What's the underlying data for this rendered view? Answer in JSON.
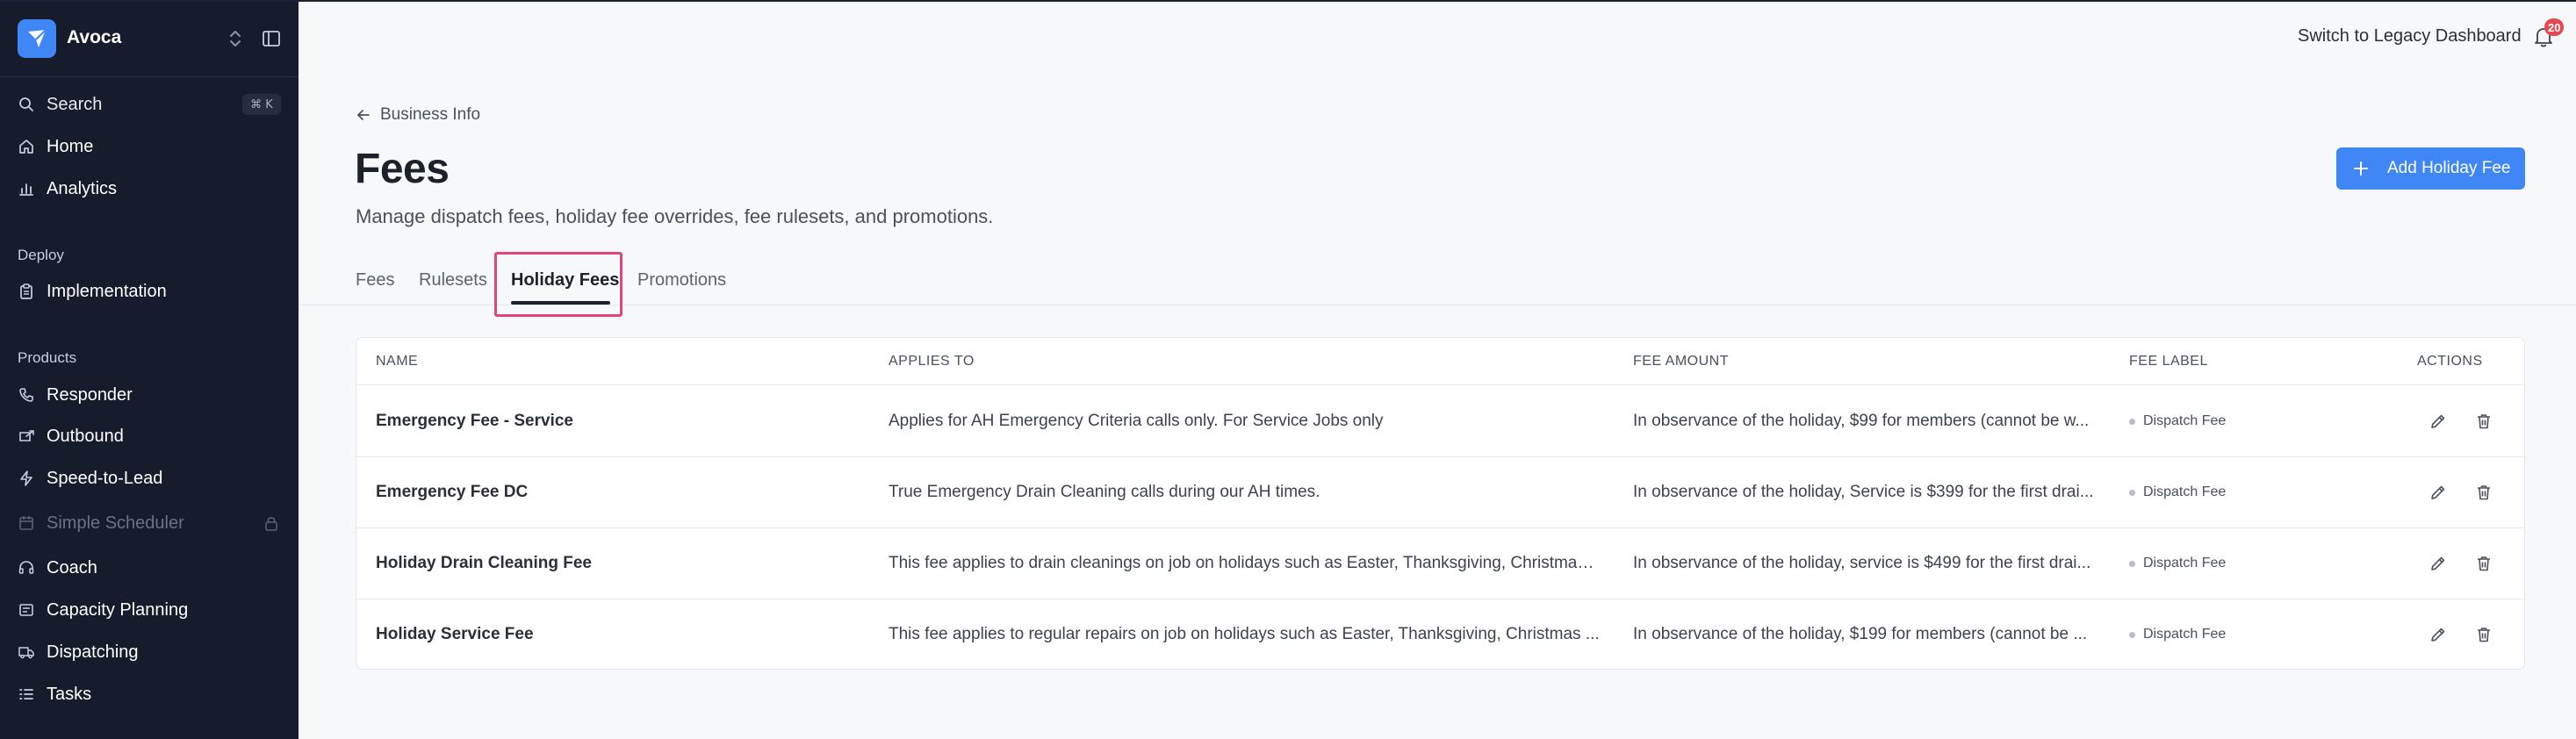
{
  "app": {
    "name": "Avoca"
  },
  "sidebar": {
    "search": {
      "label": "Search",
      "shortcut": "⌘ K"
    },
    "top_items": [
      {
        "label": "Home",
        "icon": "home-icon"
      },
      {
        "label": "Analytics",
        "icon": "bar-chart-icon"
      }
    ],
    "deploy_heading": "Deploy",
    "deploy_items": [
      {
        "label": "Implementation",
        "icon": "clipboard-icon"
      }
    ],
    "products_heading": "Products",
    "product_items": [
      {
        "label": "Responder",
        "icon": "phone-icon"
      },
      {
        "label": "Outbound",
        "icon": "outbound-icon"
      },
      {
        "label": "Speed-to-Lead",
        "icon": "bolt-icon"
      },
      {
        "label": "Simple Scheduler",
        "icon": "calendar-icon",
        "disabled": true
      },
      {
        "label": "Coach",
        "icon": "headset-icon"
      },
      {
        "label": "Capacity Planning",
        "icon": "sliders-icon"
      },
      {
        "label": "Dispatching",
        "icon": "truck-icon"
      },
      {
        "label": "Tasks",
        "icon": "list-icon"
      }
    ]
  },
  "header": {
    "legacy_link": "Switch to Legacy Dashboard",
    "notification_count": "20"
  },
  "page": {
    "back_label": "Business Info",
    "title": "Fees",
    "subtitle": "Manage dispatch fees, holiday fee overrides, fee rulesets, and promotions.",
    "add_button": "Add Holiday Fee",
    "tabs": [
      {
        "label": "Fees",
        "active": false
      },
      {
        "label": "Rulesets",
        "active": false
      },
      {
        "label": "Holiday Fees",
        "active": true
      },
      {
        "label": "Promotions",
        "active": false
      }
    ]
  },
  "table": {
    "columns": [
      "NAME",
      "APPLIES TO",
      "FEE AMOUNT",
      "FEE LABEL",
      "ACTIONS"
    ],
    "rows": [
      {
        "name": "Emergency Fee - Service",
        "applies_to": "Applies for AH Emergency Criteria calls only. For Service Jobs only",
        "fee_amount": "In observance of the holiday, $99 for members (cannot be w...",
        "fee_label": "Dispatch Fee"
      },
      {
        "name": "Emergency Fee DC",
        "applies_to": "True Emergency Drain Cleaning calls during our AH times.",
        "fee_amount": "In observance of the holiday, Service is $399 for the first drai...",
        "fee_label": "Dispatch Fee"
      },
      {
        "name": "Holiday Drain Cleaning Fee",
        "applies_to": "This fee applies to drain cleanings on job on holidays such as Easter, Thanksgiving, Christmas ...",
        "fee_amount": "In observance of the holiday, service is $499 for the first drai...",
        "fee_label": "Dispatch Fee"
      },
      {
        "name": "Holiday Service Fee",
        "applies_to": "This fee applies to regular repairs on job on holidays such as Easter, Thanksgiving, Christmas ...",
        "fee_amount": "In observance of the holiday, $199 for members (cannot be ...",
        "fee_label": "Dispatch Fee"
      }
    ]
  },
  "colors": {
    "sidebar_bg": "#161c2b",
    "accent": "#3f86f7",
    "tab_highlight": "#e0457b",
    "badge": "#e5484d"
  }
}
